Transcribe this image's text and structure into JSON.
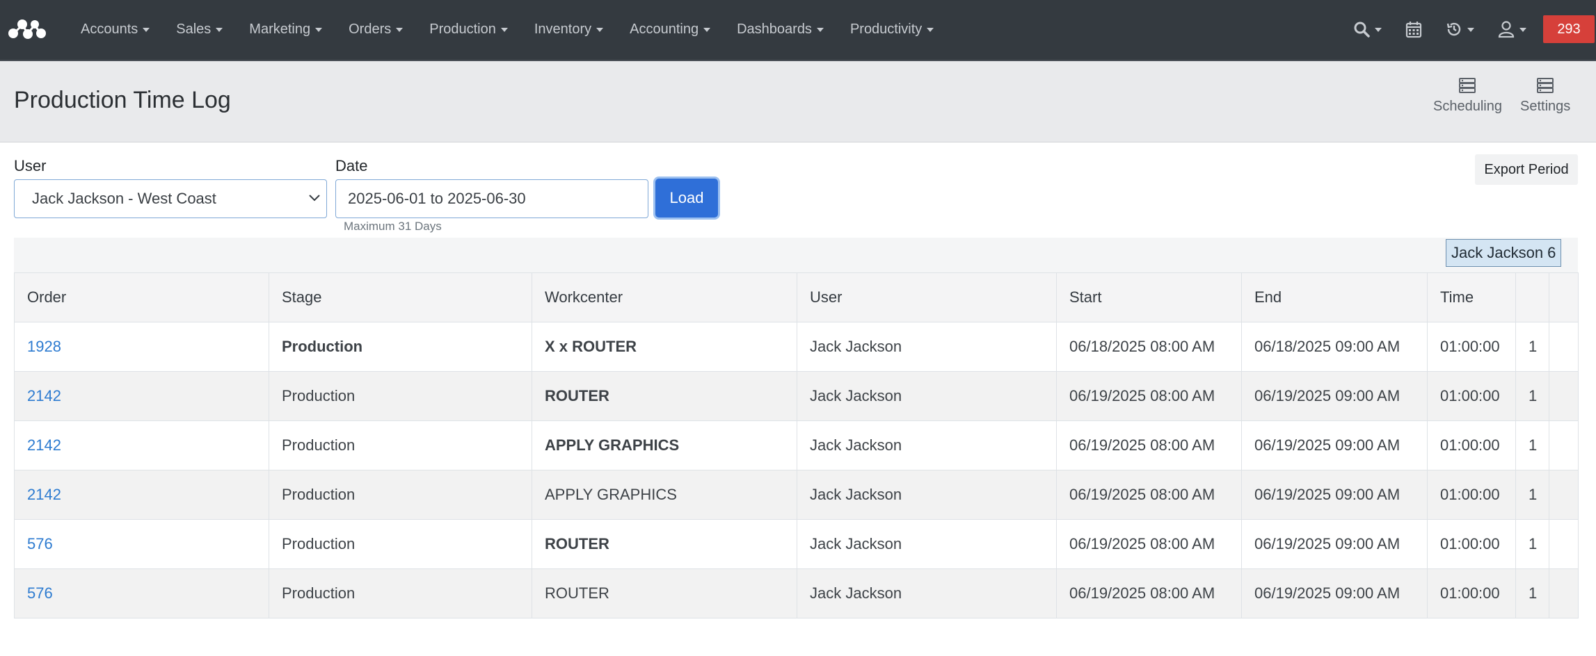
{
  "nav": {
    "menu": [
      "Accounts",
      "Sales",
      "Marketing",
      "Orders",
      "Production",
      "Inventory",
      "Accounting",
      "Dashboards",
      "Productivity"
    ],
    "badge": "293",
    "icons": [
      "search-icon",
      "calendar-icon",
      "history-icon",
      "user-icon"
    ]
  },
  "header": {
    "title": "Production Time Log",
    "scheduling_label": "Scheduling",
    "settings_label": "Settings"
  },
  "form": {
    "user_label": "User",
    "user_value": "Jack Jackson - West Coast",
    "date_label": "Date",
    "date_value": "2025-06-01 to 2025-06-30",
    "date_help": "Maximum 31 Days",
    "load_label": "Load",
    "export_label": "Export Period"
  },
  "filter_chip": "Jack Jackson 6",
  "table": {
    "headers": [
      "Order",
      "Stage",
      "Workcenter",
      "User",
      "Start",
      "End",
      "Time",
      "",
      ""
    ],
    "rows": [
      {
        "order": "1928",
        "stage": "Production",
        "workcenter": "X x ROUTER",
        "user": "Jack Jackson",
        "start": "06/18/2025 08:00 AM",
        "end": "06/18/2025 09:00 AM",
        "time": "01:00:00",
        "qty": "1"
      },
      {
        "order": "2142",
        "stage": "Production",
        "workcenter": "ROUTER",
        "user": "Jack Jackson",
        "start": "06/19/2025 08:00 AM",
        "end": "06/19/2025 09:00 AM",
        "time": "01:00:00",
        "qty": "1"
      },
      {
        "order": "2142",
        "stage": "Production",
        "workcenter": "APPLY GRAPHICS",
        "user": "Jack Jackson",
        "start": "06/19/2025 08:00 AM",
        "end": "06/19/2025 09:00 AM",
        "time": "01:00:00",
        "qty": "1"
      },
      {
        "order": "2142",
        "stage": "Production",
        "workcenter": "APPLY GRAPHICS",
        "user": "Jack Jackson",
        "start": "06/19/2025 08:00 AM",
        "end": "06/19/2025 09:00 AM",
        "time": "01:00:00",
        "qty": "1"
      },
      {
        "order": "576",
        "stage": "Production",
        "workcenter": "ROUTER",
        "user": "Jack Jackson",
        "start": "06/19/2025 08:00 AM",
        "end": "06/19/2025 09:00 AM",
        "time": "01:00:00",
        "qty": "1"
      },
      {
        "order": "576",
        "stage": "Production",
        "workcenter": "ROUTER",
        "user": "Jack Jackson",
        "start": "06/19/2025 08:00 AM",
        "end": "06/19/2025 09:00 AM",
        "time": "01:00:00",
        "qty": "1"
      }
    ]
  },
  "colors": {
    "navbar": "#343a40",
    "accent": "#2f6fd8",
    "badge": "#d6403a",
    "link": "#2d7bd0"
  }
}
